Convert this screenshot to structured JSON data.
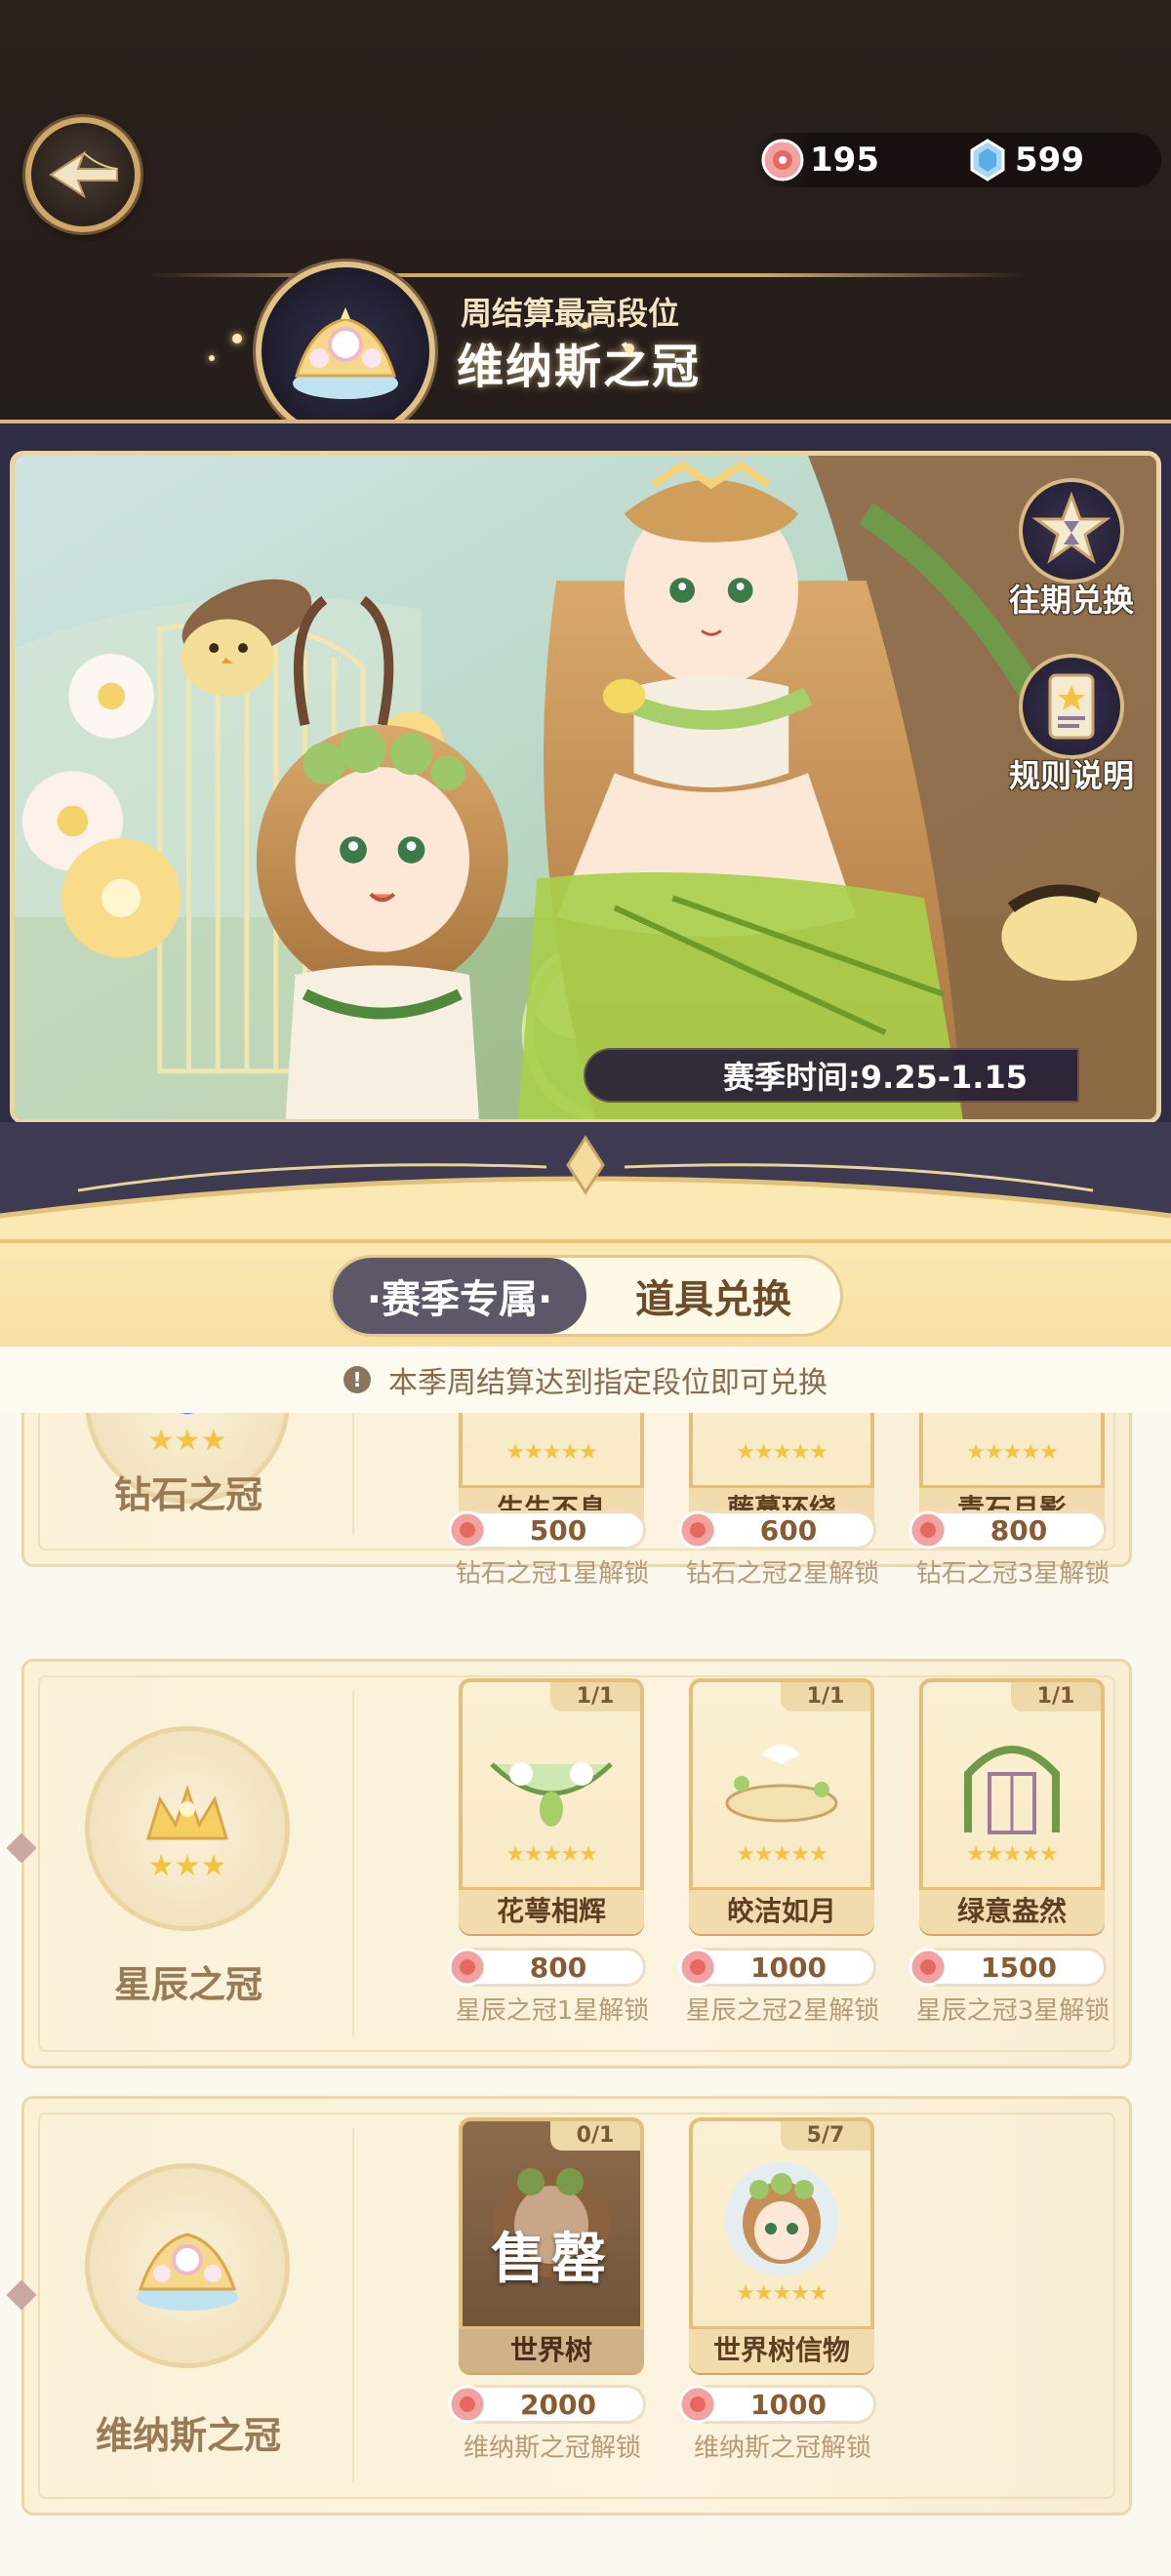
{
  "header": {
    "back_icon": "back-arrow-icon",
    "currencies": [
      {
        "icon": "ticket-coin-icon",
        "value": "195"
      },
      {
        "icon": "crystal-gem-icon",
        "value": "599"
      }
    ]
  },
  "rank": {
    "subtitle": "周结算最高段位",
    "title": "维纳斯之冠"
  },
  "banner": {
    "side_buttons": [
      {
        "icon": "hourglass-star-icon",
        "label": "往期兑换"
      },
      {
        "icon": "rules-card-icon",
        "label": "规则说明"
      }
    ],
    "season_time": "赛季时间:9.25-1.15"
  },
  "tabs": [
    {
      "label": "·赛季专属·",
      "active": true
    },
    {
      "label": "道具兑换",
      "active": false
    }
  ],
  "notice": "本季周结算达到指定段位即可兑换",
  "tiers": [
    {
      "name": "钻石之冠",
      "items": [
        {
          "name": "生生不息",
          "stars": "★★★★★",
          "price": "500",
          "unlock": "钻石之冠1星解锁"
        },
        {
          "name": "藤蔓环绕",
          "stars": "★★★★★",
          "price": "600",
          "unlock": "钻石之冠2星解锁"
        },
        {
          "name": "青石月影",
          "stars": "★★★★★",
          "price": "800",
          "unlock": "钻石之冠3星解锁"
        }
      ]
    },
    {
      "name": "星辰之冠",
      "items": [
        {
          "name": "花萼相辉",
          "count": "1/1",
          "stars": "★★★★★",
          "price": "800",
          "unlock": "星辰之冠1星解锁"
        },
        {
          "name": "皎洁如月",
          "count": "1/1",
          "stars": "★★★★★",
          "price": "1000",
          "unlock": "星辰之冠2星解锁"
        },
        {
          "name": "绿意盎然",
          "count": "1/1",
          "stars": "★★★★★",
          "price": "1500",
          "unlock": "星辰之冠3星解锁"
        }
      ]
    },
    {
      "name": "维纳斯之冠",
      "items": [
        {
          "name": "世界树",
          "count": "0/1",
          "status": "售罄",
          "price": "2000",
          "unlock": "维纳斯之冠解锁"
        },
        {
          "name": "世界树信物",
          "count": "5/7",
          "stars": "★★★★★",
          "price": "1000",
          "unlock": "维纳斯之冠解锁"
        }
      ]
    }
  ],
  "colors": {
    "gold_border": "#cfa868",
    "dark_bg": "#241c19",
    "star": "#f3c440",
    "price_text": "#8a5a30"
  }
}
